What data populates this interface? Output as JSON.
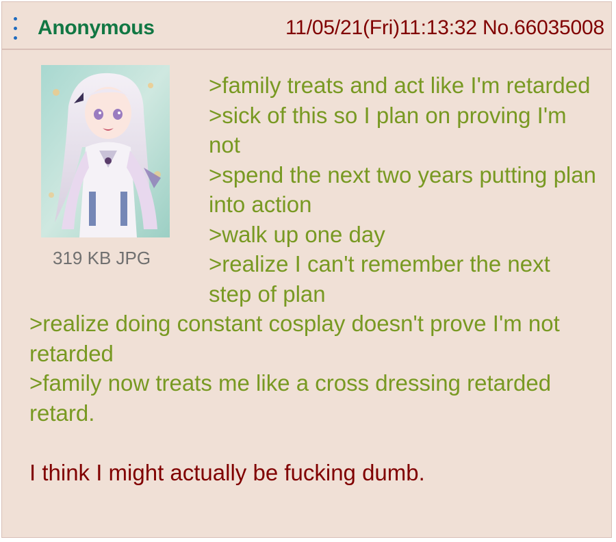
{
  "post": {
    "name": "Anonymous",
    "datetime": "11/05/21(Fri)11:13:32",
    "post_number": "No.66035008",
    "file_info": "319 KB JPG",
    "thumbnail_icon": "anime-girl-thumbnail",
    "menu_icon": "vertical-dots-menu-icon",
    "greentext_lines": [
      ">family treats and act like I'm retarded",
      ">sick of this so I plan on proving I'm not",
      ">spend the next two years putting plan into action",
      ">walk up one day",
      ">realize I can't remember the next step of plan",
      ">realize doing constant cosplay doesn't prove I'm not retarded",
      ">family now treats me like a cross dressing retarded retard."
    ],
    "closing_line": "I think I might actually be fucking dumb."
  },
  "colors": {
    "background": "#f0e0d6",
    "border": "#d9bfb7",
    "name": "#117743",
    "meta": "#800000",
    "greentext": "#789922",
    "text": "#800000",
    "file_info": "#707070",
    "menu_icon": "#1e6bbf"
  }
}
